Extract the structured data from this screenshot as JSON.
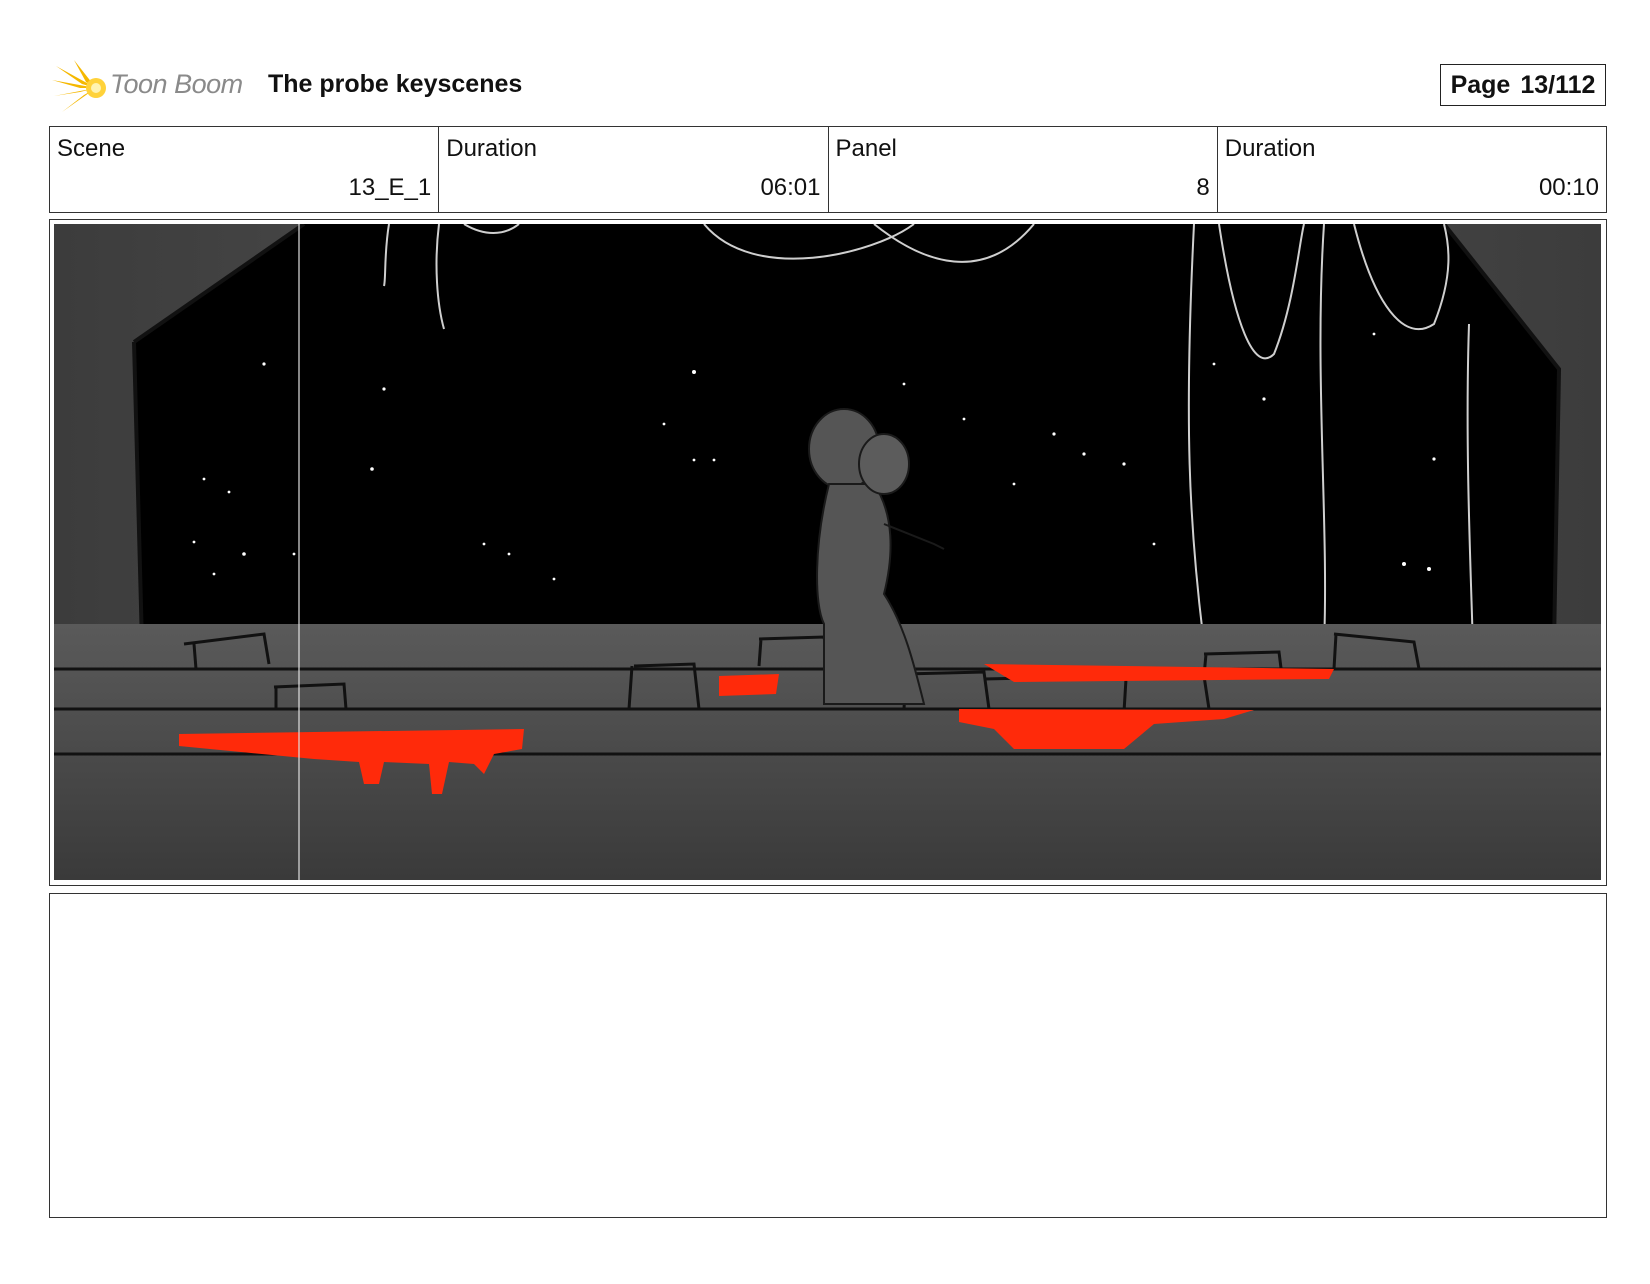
{
  "header": {
    "logo_text": "Toon Boom",
    "title": "The probe keyscenes",
    "page_label": "Page",
    "page_value": "13/112"
  },
  "info": {
    "scene_label": "Scene",
    "scene_value": "13_E_1",
    "scene_duration_label": "Duration",
    "scene_duration_value": "06:01",
    "panel_label": "Panel",
    "panel_value": "8",
    "panel_duration_label": "Duration",
    "panel_duration_value": "00:10"
  },
  "colors": {
    "accent_logo": "#f5b800",
    "lava_red": "#ff2a0a",
    "sky": "#000000",
    "floor": "#4a4a4a"
  },
  "icons": {
    "logo": "toon-boom-starburst-icon"
  },
  "notes": {
    "text": ""
  }
}
